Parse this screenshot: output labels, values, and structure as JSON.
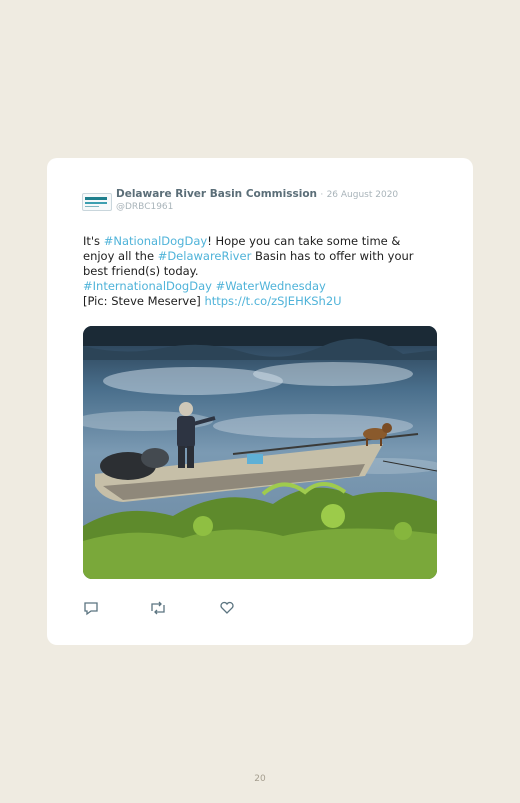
{
  "tweet": {
    "display_name": "Delaware River Basin Commission",
    "separator": "·",
    "date": "26 August 2020",
    "handle": "@DRBC1961",
    "text": {
      "p1": "It's ",
      "tag1": "#NationalDogDay",
      "p2": "! Hope you can take some time & enjoy all the ",
      "tag2": "#DelawareRiver",
      "p3": " Basin has to offer with your best friend(s) today.",
      "tag3": "#InternationalDogDay",
      "tag4": "#WaterWednesday",
      "p4": "[Pic: Steve Meserve] ",
      "link": "https://t.co/zSJEHKSh2U"
    },
    "photo_caption": "Man and dog in a boat on the river",
    "actions": [
      "reply-icon",
      "retweet-icon",
      "like-icon"
    ]
  },
  "page": {
    "number": "20"
  },
  "colors": {
    "background": "#efebe1",
    "card": "#ffffff",
    "link": "#4fb3d9"
  }
}
